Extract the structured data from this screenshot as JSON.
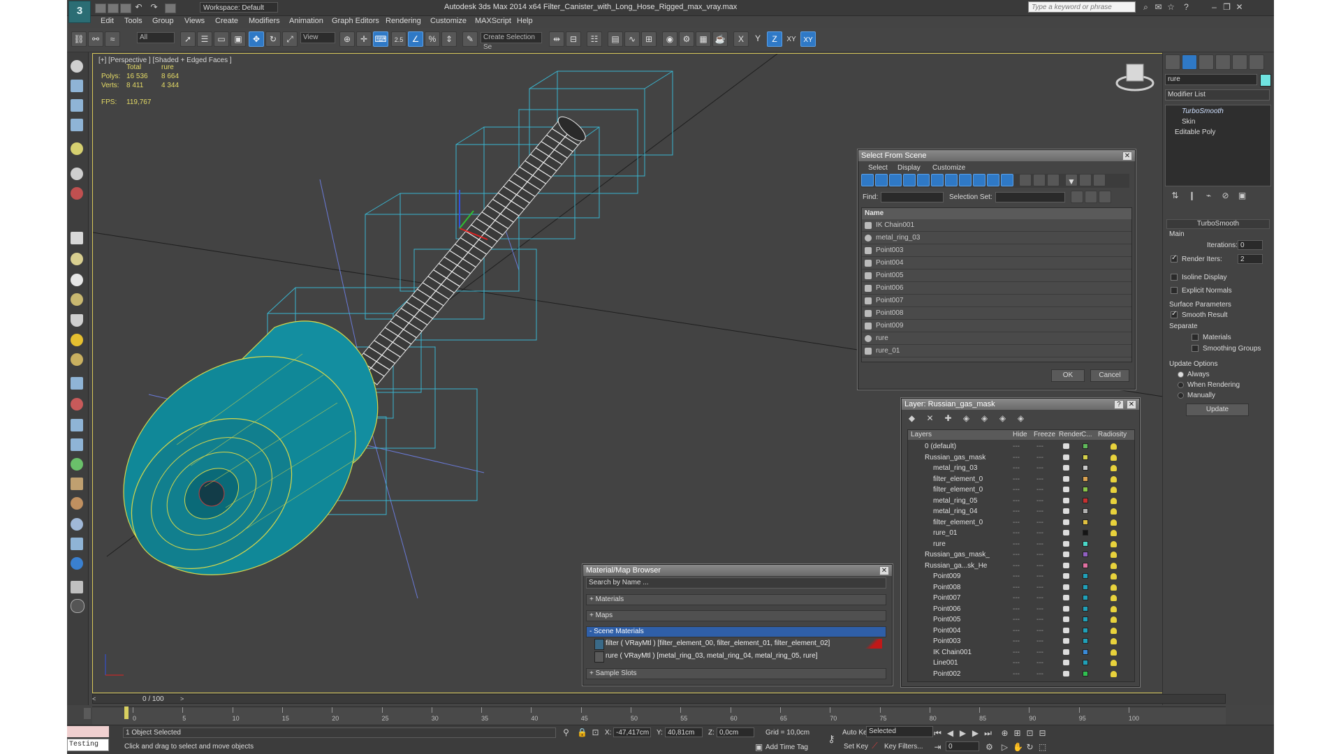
{
  "app": {
    "logo": "3",
    "workspace": "Workspace: Default",
    "title": "Autodesk 3ds Max  2014 x64    Filter_Canister_with_Long_Hose_Rigged_max_vray.max",
    "search_placeholder": "Type a keyword or phrase"
  },
  "menu": [
    "Edit",
    "Tools",
    "Group",
    "Views",
    "Create",
    "Modifiers",
    "Animation",
    "Graph Editors",
    "Rendering",
    "Customize",
    "MAXScript",
    "Help"
  ],
  "toolbar": {
    "filter_value": "All",
    "ref_coord": "View",
    "snap_value": "2.5",
    "named_sel": "Create Selection Se",
    "axis_x": "X",
    "axis_y": "Y",
    "axis_z": "Z",
    "axis_xy": "XY",
    "axis_xy_blue": "XY"
  },
  "viewport": {
    "label": "[+] [Perspective ] [Shaded + Edged Faces ]",
    "stats": {
      "col_total": "Total",
      "col_sel": "rure",
      "polys_label": "Polys:",
      "polys_total": "16 536",
      "polys_sel": "8 664",
      "verts_label": "Verts:",
      "verts_total": "8 411",
      "verts_sel": "4 344",
      "fps_label": "FPS:",
      "fps_value": "119,767"
    }
  },
  "command_panel": {
    "object_name": "rure",
    "object_color": "#6fe3e0",
    "modifier_list": "Modifier List",
    "stack": [
      "TurboSmooth",
      "Skin",
      "Editable Poly"
    ],
    "turbosmooth": {
      "header": "TurboSmooth",
      "main_label": "Main",
      "iterations_label": "Iterations:",
      "iterations": "0",
      "render_iters_label": "Render Iters:",
      "render_iters": "2",
      "isoline": "Isoline Display",
      "explicit": "Explicit Normals",
      "surface_params": "Surface Parameters",
      "smooth_result": "Smooth Result",
      "separate": "Separate",
      "materials": "Materials",
      "smoothing_groups": "Smoothing Groups",
      "update_options": "Update Options",
      "always": "Always",
      "when_rendering": "When Rendering",
      "manually": "Manually",
      "update_btn": "Update"
    }
  },
  "select_from_scene": {
    "title": "Select From Scene",
    "menu": [
      "Select",
      "Display",
      "Customize"
    ],
    "find_label": "Find:",
    "selset_label": "Selection Set:",
    "col_name": "Name",
    "items": [
      "IK Chain001",
      "metal_ring_03",
      "Point003",
      "Point004",
      "Point005",
      "Point006",
      "Point007",
      "Point008",
      "Point009",
      "rure",
      "rure_01"
    ],
    "ok": "OK",
    "cancel": "Cancel"
  },
  "layer_dialog": {
    "title": "Layer: Russian_gas_mask",
    "help": "?",
    "cols": {
      "layers": "Layers",
      "hide": "Hide",
      "freeze": "Freeze",
      "render": "Render",
      "color": "C...",
      "radiosity": "Radiosity"
    },
    "rows": [
      {
        "name": "0 (default)",
        "indent": 0,
        "color": "#5fb85a"
      },
      {
        "name": "Russian_gas_mask",
        "indent": 0,
        "color": "#d4d04a"
      },
      {
        "name": "metal_ring_03",
        "indent": 1,
        "color": "#c8c8c8"
      },
      {
        "name": "filter_element_0",
        "indent": 1,
        "color": "#d8a050"
      },
      {
        "name": "filter_element_0",
        "indent": 1,
        "color": "#88c44a"
      },
      {
        "name": "metal_ring_05",
        "indent": 1,
        "color": "#c83030"
      },
      {
        "name": "metal_ring_04",
        "indent": 1,
        "color": "#b0b0b0"
      },
      {
        "name": "filter_element_0",
        "indent": 1,
        "color": "#e0c040"
      },
      {
        "name": "rure_01",
        "indent": 1,
        "color": "#151515"
      },
      {
        "name": "rure",
        "indent": 1,
        "color": "#4ad8c8"
      },
      {
        "name": "Russian_gas_mask_",
        "indent": 0,
        "color": "#9060c0"
      },
      {
        "name": "Russian_ga...sk_He",
        "indent": 0,
        "color": "#e070a0"
      },
      {
        "name": "Point009",
        "indent": 1,
        "color": "#20a0b8"
      },
      {
        "name": "Point008",
        "indent": 1,
        "color": "#20a0b8"
      },
      {
        "name": "Point007",
        "indent": 1,
        "color": "#20a0b8"
      },
      {
        "name": "Point006",
        "indent": 1,
        "color": "#20a0b8"
      },
      {
        "name": "Point005",
        "indent": 1,
        "color": "#20a0b8"
      },
      {
        "name": "Point004",
        "indent": 1,
        "color": "#20a0b8"
      },
      {
        "name": "Point003",
        "indent": 1,
        "color": "#20a0b8"
      },
      {
        "name": "IK Chain001",
        "indent": 1,
        "color": "#3a8ad8"
      },
      {
        "name": "Line001",
        "indent": 1,
        "color": "#20a0b8"
      },
      {
        "name": "Point002",
        "indent": 1,
        "color": "#30c050"
      }
    ]
  },
  "material_browser": {
    "title": "Material/Map Browser",
    "search": "Search by Name ...",
    "materials": "+ Materials",
    "maps": "+ Maps",
    "scene_materials": "- Scene Materials",
    "mat1": "filter  ( VRayMtl )  [filter_element_00, filter_element_01, filter_element_02]",
    "mat2": "rure  ( VRayMtl )  [metal_ring_03, metal_ring_04, metal_ring_05, rure]",
    "sample_slots": "+ Sample Slots"
  },
  "timeline": {
    "frame": "0 / 100",
    "ticks": [
      "0",
      "5",
      "10",
      "15",
      "20",
      "25",
      "30",
      "35",
      "40",
      "45",
      "50",
      "55",
      "60",
      "65",
      "70",
      "75",
      "80",
      "85",
      "90",
      "95",
      "100"
    ]
  },
  "status": {
    "maxscript": "Testing for :",
    "selected": "1 Object Selected",
    "prompt": "Click and drag to select and move objects",
    "x_label": "X:",
    "x": "-47,417cm",
    "y_label": "Y:",
    "y": "40,81cm",
    "z_label": "Z:",
    "z": "0,0cm",
    "grid": "Grid = 10,0cm",
    "add_time_tag": "Add Time Tag",
    "auto_key": "Auto Key",
    "set_key": "Set Key",
    "key_mode": "Selected",
    "key_filters": "Key Filters...",
    "frame_field": "0"
  }
}
